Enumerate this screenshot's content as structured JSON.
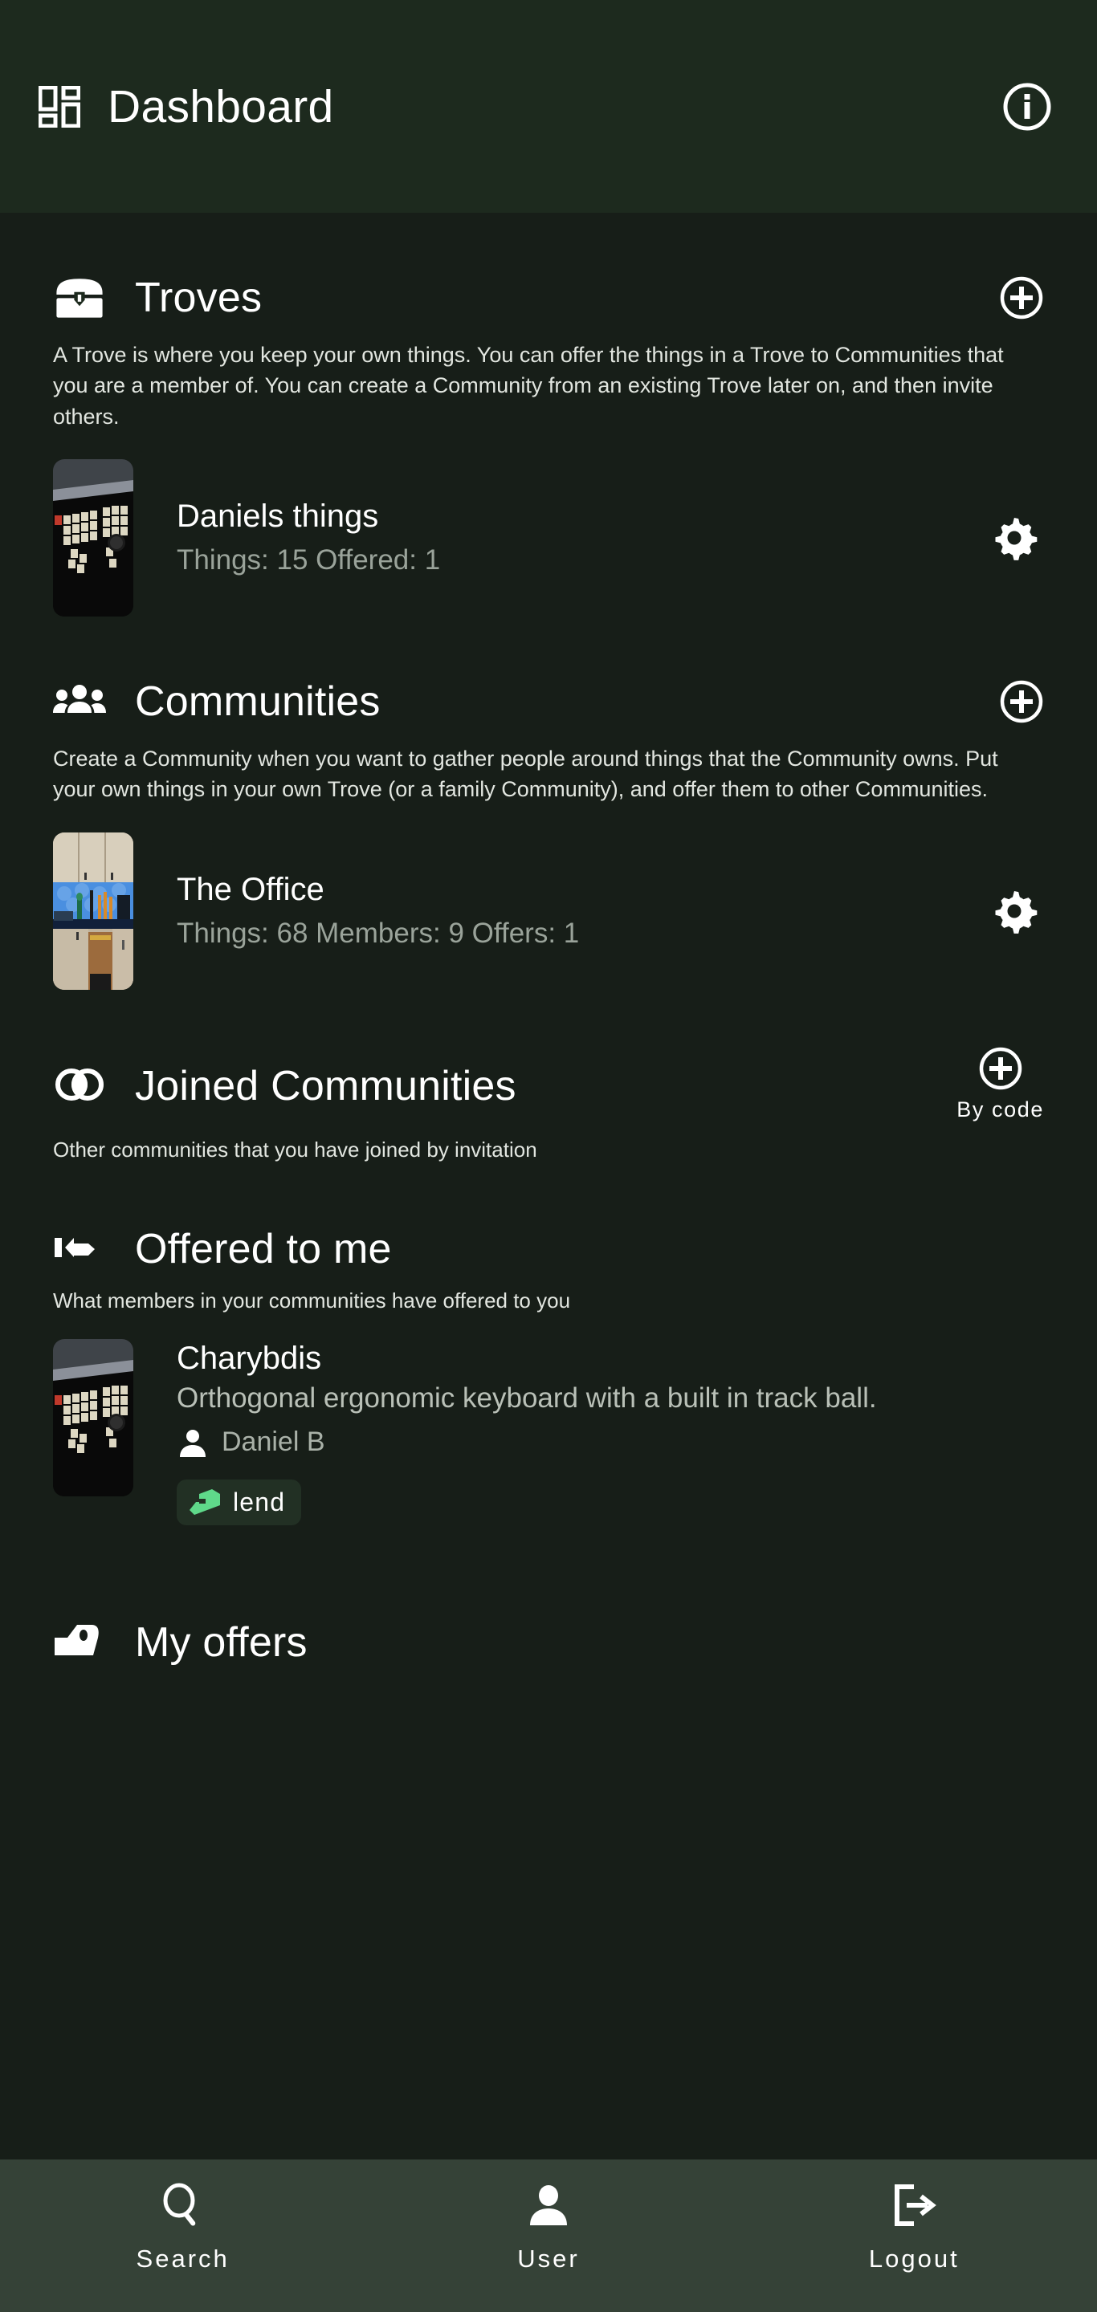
{
  "header": {
    "title": "Dashboard",
    "grid_icon": "dashboard-grid-icon",
    "info_icon": "info-circle-icon"
  },
  "sections": [
    {
      "id": "troves",
      "icon": "treasure-chest-icon",
      "title": "Troves",
      "add_icon": "plus-circle-icon",
      "description": "A Trove is where you keep your own things. You can offer the things in a Trove to Communities that you are a member of. You can create a Community from an existing Trove later on, and then invite others.",
      "items": [
        {
          "name": "Daniels things",
          "stats": "Things: 15 Offered: 1",
          "thumbnail": "ergonomic-keyboard-photo",
          "action_icon": "gear-icon"
        }
      ]
    },
    {
      "id": "communities",
      "icon": "people-group-icon",
      "title": "Communities",
      "add_icon": "plus-circle-icon",
      "description": "Create a Community when you want to gather people around things that the Community owns. Put your own things in your own Trove (or a family Community), and offer them to other Communities.",
      "items": [
        {
          "name": "The Office",
          "stats": "Things: 68 Members: 9 Offers: 1",
          "thumbnail": "kitchen-photo",
          "action_icon": "gear-icon"
        }
      ]
    },
    {
      "id": "joined-communities",
      "icon": "overlapping-circles-icon",
      "title": "Joined Communities",
      "description": "Other communities that you have joined by invitation",
      "by_code": {
        "label": "By code",
        "icon": "plus-circle-icon"
      }
    },
    {
      "id": "offered-to-me",
      "icon": "pointing-hand-icon",
      "title": "Offered to me",
      "description": "What members in your communities have offered to you",
      "offers": [
        {
          "title": "Charybdis",
          "description": "Orthogonal ergonomic keyboard with a built in track ball.",
          "owner": "Daniel B",
          "owner_icon": "person-icon",
          "badge_label": "lend",
          "badge_icon": "lend-hand-icon",
          "thumbnail": "ergonomic-keyboard-photo"
        }
      ]
    },
    {
      "id": "my-offers",
      "icon": "tag-icon",
      "title": "My offers"
    }
  ],
  "bottom_nav": [
    {
      "label": "Search",
      "icon": "search-icon"
    },
    {
      "label": "User",
      "icon": "person-icon"
    },
    {
      "label": "Logout",
      "icon": "logout-icon"
    }
  ],
  "colors": {
    "page_background": "#171e18",
    "appbar_background": "#1d2a1e",
    "bottomnav_background": "#354237",
    "text_primary": "#ffffff",
    "text_secondary": "#9aa39a",
    "accent_green": "#5fd98a",
    "badge_background": "#223024"
  }
}
